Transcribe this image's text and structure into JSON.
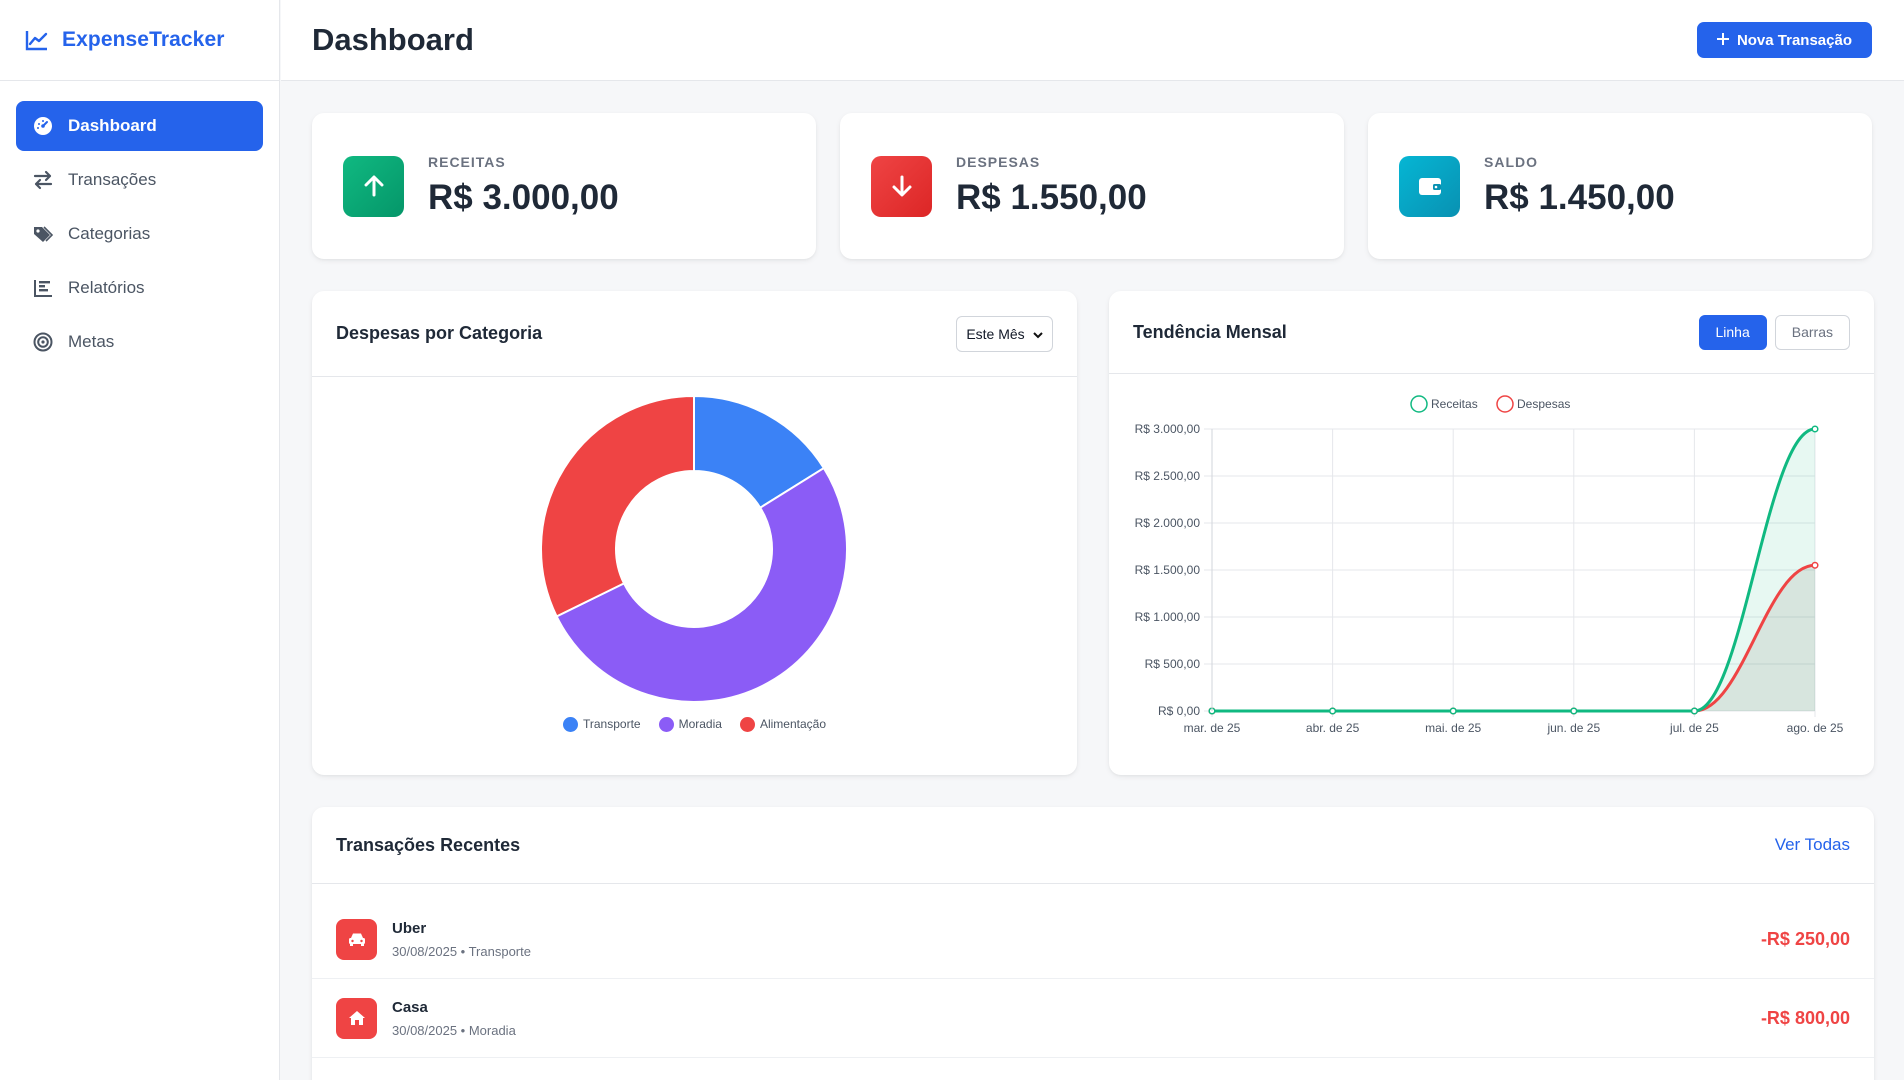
{
  "app": {
    "name": "ExpenseTracker"
  },
  "sidebar": {
    "items": [
      {
        "label": "Dashboard",
        "icon": "gauge-icon",
        "active": true
      },
      {
        "label": "Transações",
        "icon": "exchange-icon"
      },
      {
        "label": "Categorias",
        "icon": "tags-icon"
      },
      {
        "label": "Relatórios",
        "icon": "bar-chart-icon"
      },
      {
        "label": "Metas",
        "icon": "target-icon"
      }
    ]
  },
  "header": {
    "title": "Dashboard",
    "new_button": "Nova Transação"
  },
  "stats": [
    {
      "label": "RECEITAS",
      "value": "R$ 3.000,00",
      "color": "#16a34a",
      "icon": "arrow-up-icon"
    },
    {
      "label": "DESPESAS",
      "value": "R$ 1.550,00",
      "color": "#dc2626",
      "icon": "arrow-down-icon"
    },
    {
      "label": "SALDO",
      "value": "R$ 1.450,00",
      "color": "#0891b2",
      "icon": "wallet-icon"
    }
  ],
  "category_panel": {
    "title": "Despesas por Categoria",
    "period": "Este Mês"
  },
  "trend_panel": {
    "title": "Tendência Mensal",
    "toggle_line": "Linha",
    "toggle_bars": "Barras"
  },
  "chart_data": [
    {
      "type": "pie",
      "variant": "donut",
      "categories": [
        "Transporte",
        "Moradia",
        "Alimentação"
      ],
      "values": [
        250,
        800,
        500
      ],
      "colors": [
        "#3b82f6",
        "#8b5cf6",
        "#ef4444"
      ],
      "legend": "bottom"
    },
    {
      "type": "line",
      "categories": [
        "mar. de 25",
        "abr. de 25",
        "mai. de 25",
        "jun. de 25",
        "jul. de 25",
        "ago. de 25"
      ],
      "series": [
        {
          "name": "Receitas",
          "values": [
            0,
            0,
            0,
            0,
            0,
            3000
          ],
          "color": "#10b981"
        },
        {
          "name": "Despesas",
          "values": [
            0,
            0,
            0,
            0,
            0,
            1550
          ],
          "color": "#ef4444"
        }
      ],
      "yticks": [
        "R$ 0,00",
        "R$ 500,00",
        "R$ 1.000,00",
        "R$ 1.500,00",
        "R$ 2.000,00",
        "R$ 2.500,00",
        "R$ 3.000,00"
      ],
      "ylim": [
        0,
        3000
      ],
      "grid": true,
      "legend": "top"
    }
  ],
  "transactions": {
    "title": "Transações Recentes",
    "view_all": "Ver Todas",
    "items": [
      {
        "name": "Uber",
        "meta": "30/08/2025 • Transporte",
        "amount": "-R$ 250,00",
        "icon": "car-icon"
      },
      {
        "name": "Casa",
        "meta": "30/08/2025 • Moradia",
        "amount": "-R$ 800,00",
        "icon": "home-icon"
      }
    ]
  }
}
